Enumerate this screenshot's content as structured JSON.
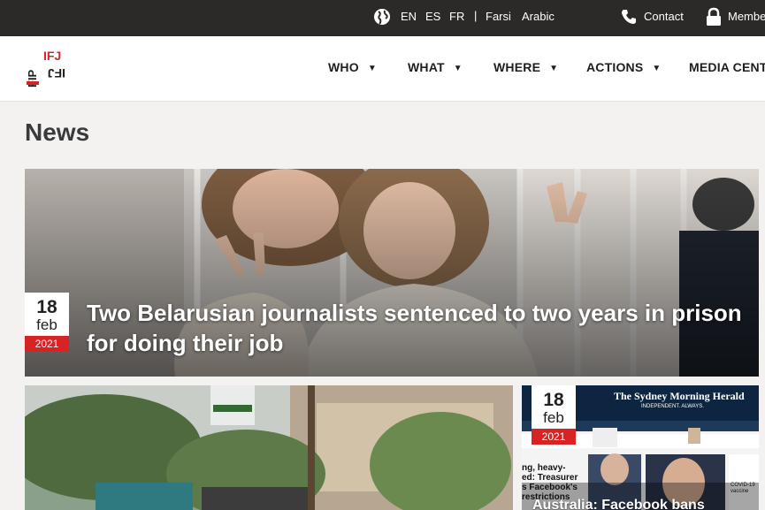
{
  "topbar": {
    "languages": [
      "EN",
      "ES",
      "FR"
    ],
    "separator": "|",
    "languages_extra": [
      "Farsi",
      "Arabic"
    ],
    "contact_label": "Contact",
    "members_label": "Members"
  },
  "logo": {
    "text_top": "IFJ",
    "text_side": "FIP"
  },
  "nav": {
    "items": [
      {
        "label": "WHO"
      },
      {
        "label": "WHAT"
      },
      {
        "label": "WHERE"
      },
      {
        "label": "ACTIONS"
      },
      {
        "label": "MEDIA CENTRE"
      }
    ]
  },
  "page": {
    "title": "News"
  },
  "hero": {
    "date": {
      "day": "18",
      "month": "feb",
      "year": "2021"
    },
    "title": "Two Belarusian journalists sentenced to two years in prison for doing their job"
  },
  "cards": [
    {
      "image_alt": "street"
    },
    {
      "date": {
        "day": "18",
        "month": "feb",
        "year": "2021"
      },
      "masthead": "The Sydney Morning Herald",
      "tagline": "INDEPENDENT. ALWAYS.",
      "headline_snippet_1": "ng, heavy-",
      "headline_snippet_2": "ed: Treasurer",
      "headline_snippet_3": "s Facebook's",
      "headline_snippet_4": "restrictions",
      "headline_snippet_5": "COVID-19 vaccine",
      "title": "Australia: Facebook bans"
    }
  ],
  "colors": {
    "topbar": "#2c2a29",
    "accent_red": "#d72323",
    "background": "#f3f2f1"
  }
}
